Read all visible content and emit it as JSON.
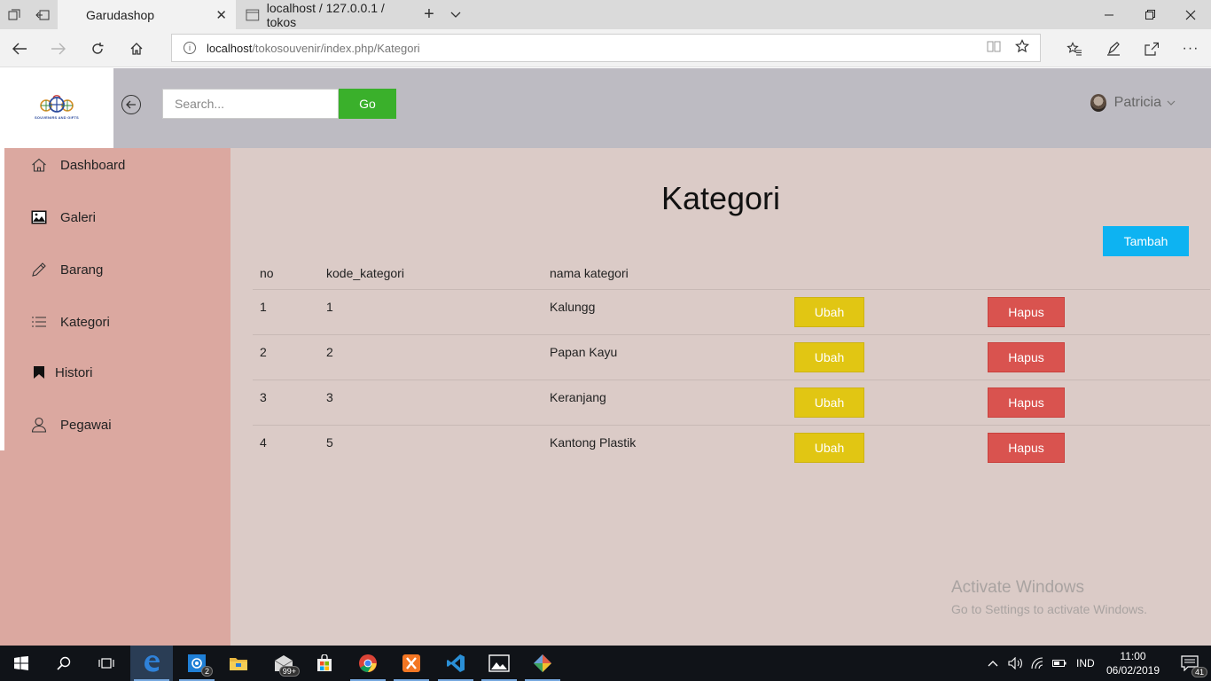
{
  "browser": {
    "tabs": [
      {
        "title": "Garudashop",
        "active": true
      },
      {
        "title": "localhost / 127.0.0.1 / tokos",
        "active": false
      }
    ],
    "address": {
      "host": "localhost",
      "path": "/tokosouvenir/index.php/Kategori"
    }
  },
  "app": {
    "logo_text": "SOUVENIRS AND GIFTS",
    "search": {
      "placeholder": "Search...",
      "value": "",
      "button": "Go"
    },
    "user": {
      "name": "Patricia"
    }
  },
  "sidebar": {
    "items": [
      {
        "label": "Dashboard",
        "icon": "home-icon"
      },
      {
        "label": "Galeri",
        "icon": "image-icon"
      },
      {
        "label": "Barang",
        "icon": "pencil-icon"
      },
      {
        "label": "Kategori",
        "icon": "list-icon"
      },
      {
        "label": "Histori",
        "icon": "bookmark-icon"
      },
      {
        "label": "Pegawai",
        "icon": "user-icon"
      }
    ]
  },
  "main": {
    "title": "Kategori",
    "add_button": "Tambah",
    "table": {
      "headers": [
        "no",
        "kode_kategori",
        "nama kategori"
      ],
      "rows": [
        {
          "no": "1",
          "kode": "1",
          "nama": "Kalungg",
          "edit": "Ubah",
          "delete": "Hapus"
        },
        {
          "no": "2",
          "kode": "2",
          "nama": "Papan Kayu",
          "edit": "Ubah",
          "delete": "Hapus"
        },
        {
          "no": "3",
          "kode": "3",
          "nama": "Keranjang",
          "edit": "Ubah",
          "delete": "Hapus"
        },
        {
          "no": "4",
          "kode": "5",
          "nama": "Kantong Plastik",
          "edit": "Ubah",
          "delete": "Hapus"
        }
      ]
    }
  },
  "watermark": {
    "line1": "Activate Windows",
    "line2": "Go to Settings to activate Windows."
  },
  "taskbar": {
    "apps": [
      "start-icon",
      "search-icon",
      "task-view-icon",
      "edge-icon",
      "mail-icon",
      "file-explorer-icon",
      "mail-bag-icon",
      "store-icon",
      "chrome-icon",
      "xampp-icon",
      "vscode-icon",
      "photos-icon",
      "git-icon"
    ],
    "badges": {
      "mail": "2",
      "mail_bag": "99+",
      "notifications": "41"
    },
    "language": "IND",
    "time": "11:00",
    "date": "06/02/2019"
  },
  "colors": {
    "topbar": "#bdbbc2",
    "sidebar": "#dba8a0",
    "content": "#dbcbc7",
    "go_button": "#3ab02b",
    "add_button": "#0db3f2",
    "edit_button": "#e1c613",
    "delete_button": "#d9534f"
  }
}
